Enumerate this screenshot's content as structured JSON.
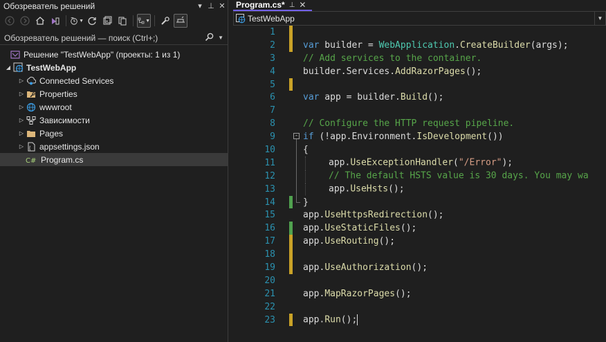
{
  "solution_explorer": {
    "title": "Обозреватель решений",
    "title_buttons": [
      "▾",
      "⊥",
      "✕"
    ],
    "search_placeholder": "Обозреватель решений — поиск (Ctrl+;)",
    "tree": [
      {
        "label": "Решение \"TestWebApp\" (проекты: 1 из 1)",
        "icon": "solution-icon",
        "indent": 0,
        "arrow": "",
        "bold": false
      },
      {
        "label": "TestWebApp",
        "icon": "web-project-icon",
        "indent": 1,
        "arrow": "◢",
        "bold": true
      },
      {
        "label": "Connected Services",
        "icon": "connected-services-icon",
        "indent": 2,
        "arrow": "▷",
        "bold": false
      },
      {
        "label": "Properties",
        "icon": "properties-icon",
        "indent": 2,
        "arrow": "▷",
        "bold": false
      },
      {
        "label": "wwwroot",
        "icon": "globe-icon",
        "indent": 2,
        "arrow": "▷",
        "bold": false
      },
      {
        "label": "Зависимости",
        "icon": "dependencies-icon",
        "indent": 2,
        "arrow": "▷",
        "bold": false
      },
      {
        "label": "Pages",
        "icon": "folder-icon",
        "indent": 2,
        "arrow": "▷",
        "bold": false
      },
      {
        "label": "appsettings.json",
        "icon": "json-file-icon",
        "indent": 2,
        "arrow": "▷",
        "bold": false
      },
      {
        "label": "Program.cs",
        "icon": "csharp-file-icon",
        "indent": 2,
        "arrow": "",
        "bold": false,
        "selected": true
      }
    ]
  },
  "editor": {
    "tab_label": "Program.cs*",
    "tab_pin": "⊥",
    "tab_close": "✕",
    "nav_project": "TestWebApp",
    "lines": [
      {
        "n": "1",
        "change": "yellow",
        "tokens": []
      },
      {
        "n": "2",
        "change": "yellow",
        "tokens": [
          [
            "kw",
            "var"
          ],
          [
            "plain",
            " builder = "
          ],
          [
            "type",
            "WebApplication"
          ],
          [
            "plain",
            "."
          ],
          [
            "meth",
            "CreateBuilder"
          ],
          [
            "plain",
            "(args);"
          ]
        ]
      },
      {
        "n": "3",
        "change": "none",
        "tokens": [
          [
            "cmt",
            "// Add services to the container."
          ]
        ]
      },
      {
        "n": "4",
        "change": "none",
        "tokens": [
          [
            "plain",
            "builder.Services."
          ],
          [
            "meth",
            "AddRazorPages"
          ],
          [
            "plain",
            "();"
          ]
        ]
      },
      {
        "n": "5",
        "change": "yellow",
        "tokens": []
      },
      {
        "n": "6",
        "change": "none",
        "tokens": [
          [
            "kw",
            "var"
          ],
          [
            "plain",
            " app = builder."
          ],
          [
            "meth",
            "Build"
          ],
          [
            "plain",
            "();"
          ]
        ]
      },
      {
        "n": "7",
        "change": "none",
        "tokens": []
      },
      {
        "n": "8",
        "change": "none",
        "tokens": [
          [
            "cmt",
            "// Configure the HTTP request pipeline."
          ]
        ]
      },
      {
        "n": "9",
        "change": "none",
        "outline": "start",
        "tokens": [
          [
            "kw",
            "if"
          ],
          [
            "plain",
            " (!app.Environment."
          ],
          [
            "meth",
            "IsDevelopment"
          ],
          [
            "plain",
            "())"
          ]
        ]
      },
      {
        "n": "10",
        "change": "none",
        "outline": "mid",
        "tokens": [
          [
            "plain",
            "{"
          ]
        ]
      },
      {
        "n": "11",
        "change": "none",
        "outline": "mid",
        "guide": true,
        "tokens": [
          [
            "plain",
            "app."
          ],
          [
            "meth",
            "UseExceptionHandler"
          ],
          [
            "plain",
            "("
          ],
          [
            "str",
            "\"/Error\""
          ],
          [
            "plain",
            ");"
          ]
        ]
      },
      {
        "n": "12",
        "change": "none",
        "outline": "mid",
        "guide": true,
        "tokens": [
          [
            "cmt",
            "// The default HSTS value is 30 days. You may wa"
          ]
        ]
      },
      {
        "n": "13",
        "change": "none",
        "outline": "mid",
        "guide": true,
        "tokens": [
          [
            "plain",
            "app."
          ],
          [
            "meth",
            "UseHsts"
          ],
          [
            "plain",
            "();"
          ]
        ]
      },
      {
        "n": "14",
        "change": "green",
        "outline": "end",
        "tokens": [
          [
            "plain",
            "}"
          ]
        ]
      },
      {
        "n": "15",
        "change": "none",
        "tokens": [
          [
            "plain",
            "app."
          ],
          [
            "meth",
            "UseHttpsRedirection"
          ],
          [
            "plain",
            "();"
          ]
        ]
      },
      {
        "n": "16",
        "change": "green",
        "tokens": [
          [
            "plain",
            "app."
          ],
          [
            "meth",
            "UseStaticFiles"
          ],
          [
            "plain",
            "();"
          ]
        ]
      },
      {
        "n": "17",
        "change": "yellow",
        "tokens": [
          [
            "plain",
            "app."
          ],
          [
            "meth",
            "UseRouting"
          ],
          [
            "plain",
            "();"
          ]
        ]
      },
      {
        "n": "18",
        "change": "yellow",
        "tokens": []
      },
      {
        "n": "19",
        "change": "yellow",
        "tokens": [
          [
            "plain",
            "app."
          ],
          [
            "meth",
            "UseAuthorization"
          ],
          [
            "plain",
            "();"
          ]
        ]
      },
      {
        "n": "20",
        "change": "none",
        "tokens": []
      },
      {
        "n": "21",
        "change": "none",
        "tokens": [
          [
            "plain",
            "app."
          ],
          [
            "meth",
            "MapRazorPages"
          ],
          [
            "plain",
            "();"
          ]
        ]
      },
      {
        "n": "22",
        "change": "none",
        "tokens": []
      },
      {
        "n": "23",
        "change": "yellow",
        "cursor": true,
        "tokens": [
          [
            "plain",
            "app."
          ],
          [
            "meth",
            "Run"
          ],
          [
            "plain",
            "();"
          ]
        ]
      }
    ]
  }
}
